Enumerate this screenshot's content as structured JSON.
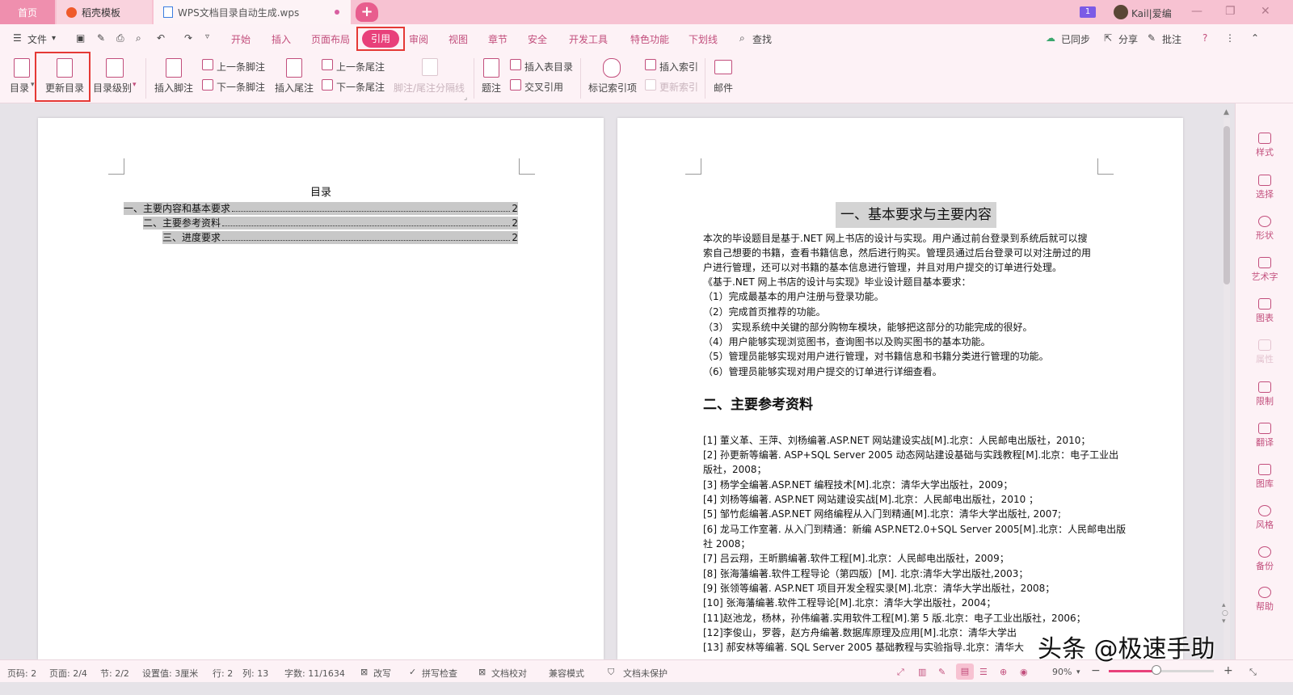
{
  "titlebar": {
    "tabs": [
      "首页",
      "稻壳模板",
      "WPS文档目录自动生成.wps"
    ],
    "notification_count": "1",
    "username": "Kail|爱编"
  },
  "menu": {
    "file": "文件",
    "items": [
      "开始",
      "插入",
      "页面布局",
      "引用",
      "审阅",
      "视图",
      "章节",
      "安全",
      "开发工具",
      "特色功能",
      "下划线"
    ],
    "active": "引用",
    "search": "查找",
    "right": [
      "已同步",
      "分享",
      "批注"
    ]
  },
  "ribbon": {
    "toc": "目录",
    "update_toc": "更新目录",
    "toc_level": "目录级别",
    "insert_footnote": "插入脚注",
    "prev_footnote": "上一条脚注",
    "next_footnote": "下一条脚注",
    "insert_endnote": "插入尾注",
    "prev_endnote": "上一条尾注",
    "next_endnote": "下一条尾注",
    "note_separator": "脚注/尾注分隔线",
    "caption": "题注",
    "insert_table_of_figures": "插入表目录",
    "cross_reference": "交叉引用",
    "mark_index_entry": "标记索引项",
    "insert_index": "插入索引",
    "update_index": "更新索引",
    "mail": "邮件"
  },
  "page_left": {
    "toc_title": "目录",
    "entries": [
      {
        "text": "一、主要内容和基本要求",
        "page": "2"
      },
      {
        "text": "二、主要参考资料",
        "page": "2"
      },
      {
        "text": "三、进度要求",
        "page": "2"
      }
    ]
  },
  "page_right": {
    "heading1": "一、基本要求与主要内容",
    "paragraphs": [
      "本次的毕设题目是基于.NET 网上书店的设计与实现。用户通过前台登录到系统后就可以搜",
      "索自己想要的书籍，查看书籍信息，然后进行购买。管理员通过后台登录可以对注册过的用",
      "户进行管理，还可以对书籍的基本信息进行管理，并且对用户提交的订单进行处理。",
      "《基于.NET 网上书店的设计与实现》毕业设计题目基本要求：",
      "（1）完成最基本的用户注册与登录功能。",
      "（2）完成首页推荐的功能。",
      "（3）  实现系统中关键的部分购物车模块，能够把这部分的功能完成的很好。",
      "（4）用户能够实现浏览图书，查询图书以及购买图书的基本功能。",
      "（5）管理员能够实现对用户进行管理，对书籍信息和书籍分类进行管理的功能。",
      "（6）管理员能够实现对用户提交的订单进行详细查看。"
    ],
    "heading2": "二、主要参考资料",
    "references": [
      "[1]  董义革、王萍、刘杨编著.ASP.NET 网站建设实战[M].北京：人民邮电出版社，2010；",
      "[2]  孙更新等编著. ASP+SQL Server 2005 动态网站建设基础与实践教程[M].北京：电子工业出",
      "版社，2008；",
      "[3]  杨学全编著.ASP.NET 编程技术[M].北京：清华大学出版社，2009；",
      "[4]  刘杨等编著. ASP.NET 网站建设实战[M].北京：人民邮电出版社，2010 ；",
      "[5]  邹竹彪编著.ASP.NET 网络编程从入门到精通[M].北京：清华大学出版社, 2007;",
      "[6]  龙马工作室著.  从入门到精通：新编 ASP.NET2.0+SQL Server 2005[M].北京：人民邮电出版",
      "社 2008；",
      "[7]  吕云翔，王昕鹏编著.软件工程[M].北京：人民邮电出版社，2009；",
      "[8]  张海藩编著.软件工程导论（第四版）[M]. 北京:清华大学出版社,2003；",
      "[9]  张领等编著. ASP.NET 项目开发全程实录[M].北京：清华大学出版社，2008；",
      "[10]  张海藩编著.软件工程导论[M].北京：清华大学出版社，2004；",
      "[11]赵池龙，杨林，孙伟编著.实用软件工程[M].第 5 版.北京：电子工业出版社，2006；",
      "[12]李俊山，罗蓉，赵方舟编著.数据库原理及应用[M].北京：清华大学出",
      "[13]  郝安林等编著. SQL Server 2005 基础教程与实验指导.北京：清华大"
    ]
  },
  "sidepanel": [
    "样式",
    "选择",
    "形状",
    "艺术字",
    "图表",
    "属性",
    "限制",
    "翻译",
    "图库",
    "风格",
    "备份",
    "帮助"
  ],
  "statusbar": {
    "page": "页码: 2",
    "pages": "页面: 2/4",
    "section": "节: 2/2",
    "setting": "设置值: 3厘米",
    "row": "行: 2",
    "col": "列: 13",
    "words": "字数: 11/1634",
    "revise": "改写",
    "spell": "拼写检查",
    "proof": "文档校对",
    "compat": "兼容模式",
    "protect": "文档未保护",
    "zoom": "90%",
    "zoom_level": 0.45
  },
  "watermark": "头条 @极速手助",
  "colors": {
    "accent": "#e8407a",
    "highlight_box": "#e53935"
  }
}
